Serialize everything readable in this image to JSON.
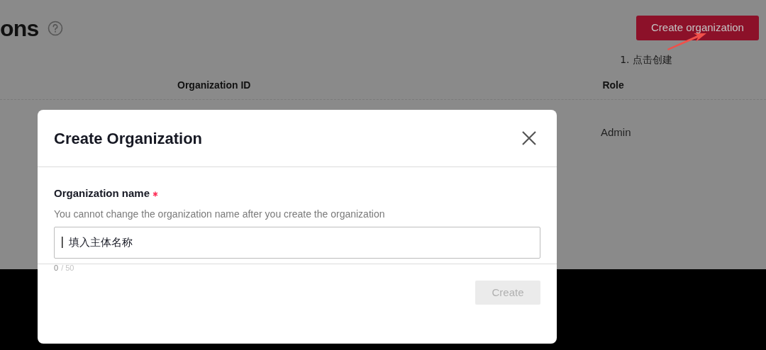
{
  "page": {
    "title": "ons",
    "create_button": {
      "label": "Create organization"
    },
    "annotation": "1. 点击创建"
  },
  "table": {
    "columns": [
      "Organization ID",
      "Role"
    ],
    "rows": [
      {
        "role": "Admin"
      }
    ]
  },
  "dialog": {
    "title": "Create Organization",
    "field": {
      "label": "Organization name",
      "required": true,
      "helper": "You cannot change the organization name after you create the organization",
      "value": "填入主体名称",
      "count": "0",
      "limit": "/ 50"
    },
    "submit": {
      "label": "Create",
      "disabled": true
    }
  }
}
